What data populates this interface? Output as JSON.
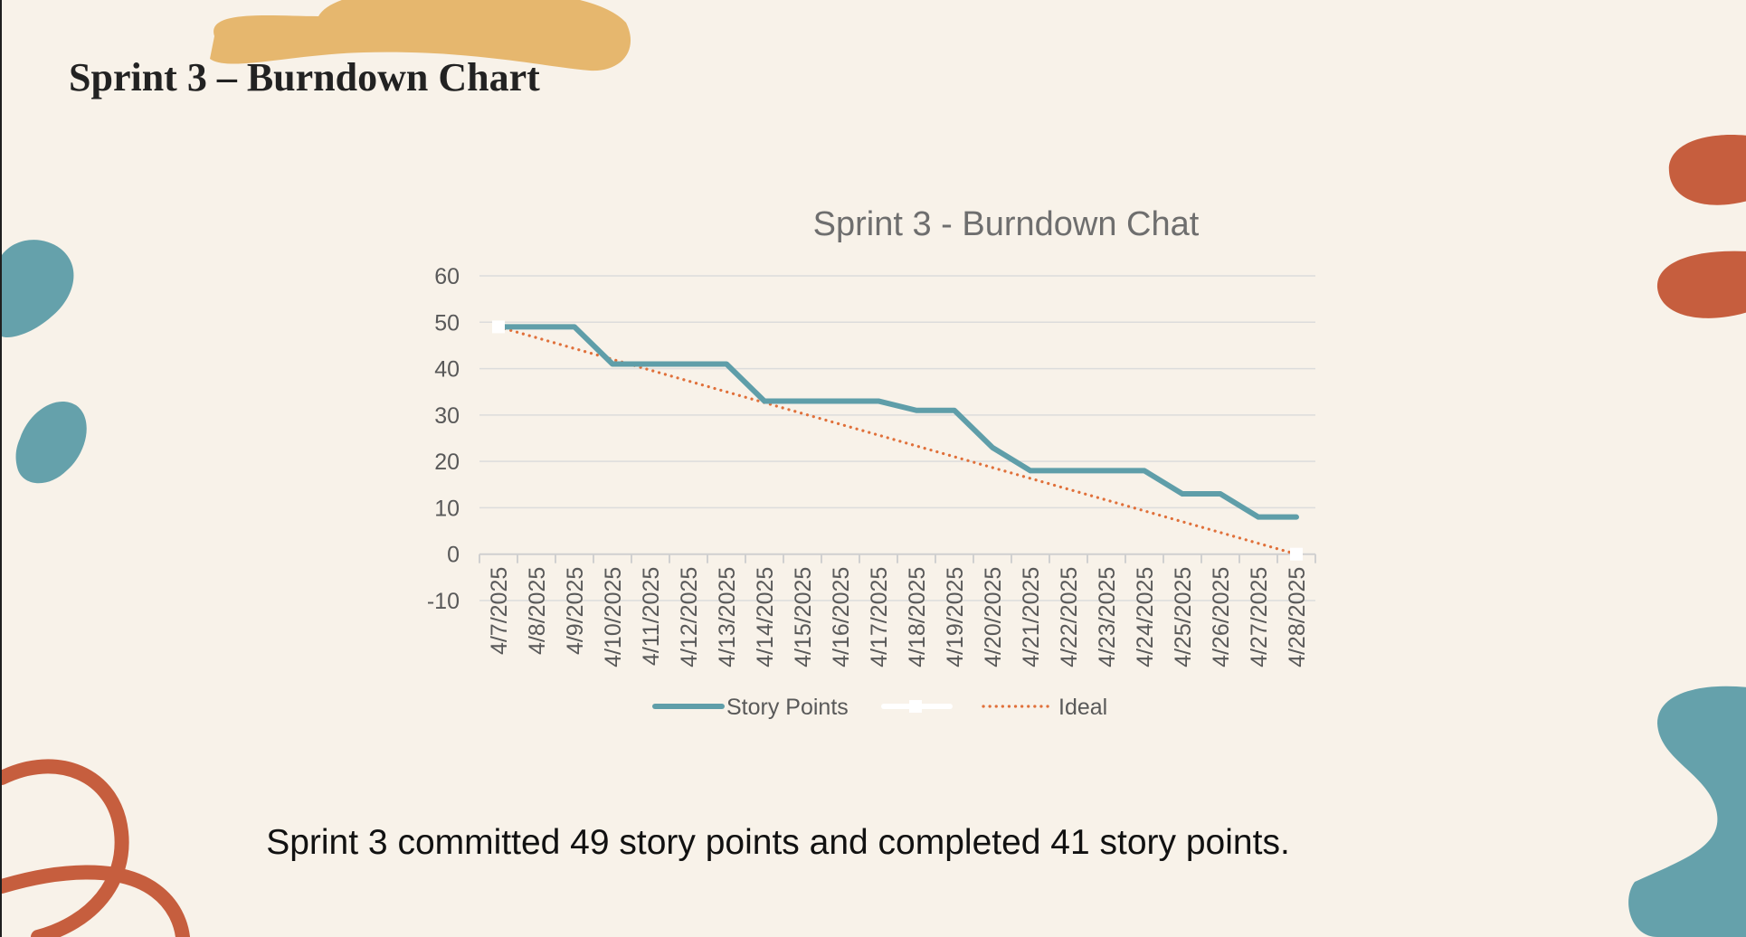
{
  "slide": {
    "title": "Sprint 3 – Burndown Chart",
    "summary": "Sprint 3 committed 49 story points and completed 41 story points."
  },
  "colors": {
    "background": "#f8f2e9",
    "story_points": "#5f9ea9",
    "ideal": "#e0703a",
    "marker_series": "#ffffff",
    "gridline": "#dcdcdc",
    "axis_text": "#595959",
    "chart_title": "#6e6e6e",
    "blob_mustard": "#e6b76e",
    "blob_teal": "#65a1ab",
    "blob_rust": "#c65e3e"
  },
  "chart_data": {
    "type": "line",
    "title": "Sprint 3 - Burndown Chat",
    "xlabel": "",
    "ylabel": "",
    "ylim": [
      -10,
      60
    ],
    "yticks": [
      -10,
      0,
      10,
      20,
      30,
      40,
      50,
      60
    ],
    "grid": true,
    "legend_position": "bottom",
    "categories": [
      "4/7/2025",
      "4/8/2025",
      "4/9/2025",
      "4/10/2025",
      "4/11/2025",
      "4/12/2025",
      "4/13/2025",
      "4/14/2025",
      "4/15/2025",
      "4/16/2025",
      "4/17/2025",
      "4/18/2025",
      "4/19/2025",
      "4/20/2025",
      "4/21/2025",
      "4/22/2025",
      "4/23/2025",
      "4/24/2025",
      "4/25/2025",
      "4/26/2025",
      "4/27/2025",
      "4/28/2025"
    ],
    "series": [
      {
        "name": "Story Points",
        "style": "solid",
        "values": [
          49,
          49,
          49,
          41,
          41,
          41,
          41,
          33,
          33,
          33,
          33,
          31,
          31,
          23,
          18,
          18,
          18,
          18,
          13,
          13,
          8,
          8
        ]
      },
      {
        "name": "",
        "style": "markers",
        "values": [
          49,
          null,
          null,
          null,
          null,
          null,
          null,
          null,
          null,
          null,
          null,
          null,
          null,
          null,
          null,
          null,
          null,
          null,
          null,
          null,
          null,
          0
        ]
      },
      {
        "name": "Ideal",
        "style": "dotted",
        "values": [
          49,
          46.67,
          44.33,
          42,
          39.67,
          37.33,
          35,
          32.67,
          30.33,
          28,
          25.67,
          23.33,
          21,
          18.67,
          16.33,
          14,
          11.67,
          9.33,
          7,
          4.67,
          2.33,
          0
        ]
      }
    ]
  }
}
